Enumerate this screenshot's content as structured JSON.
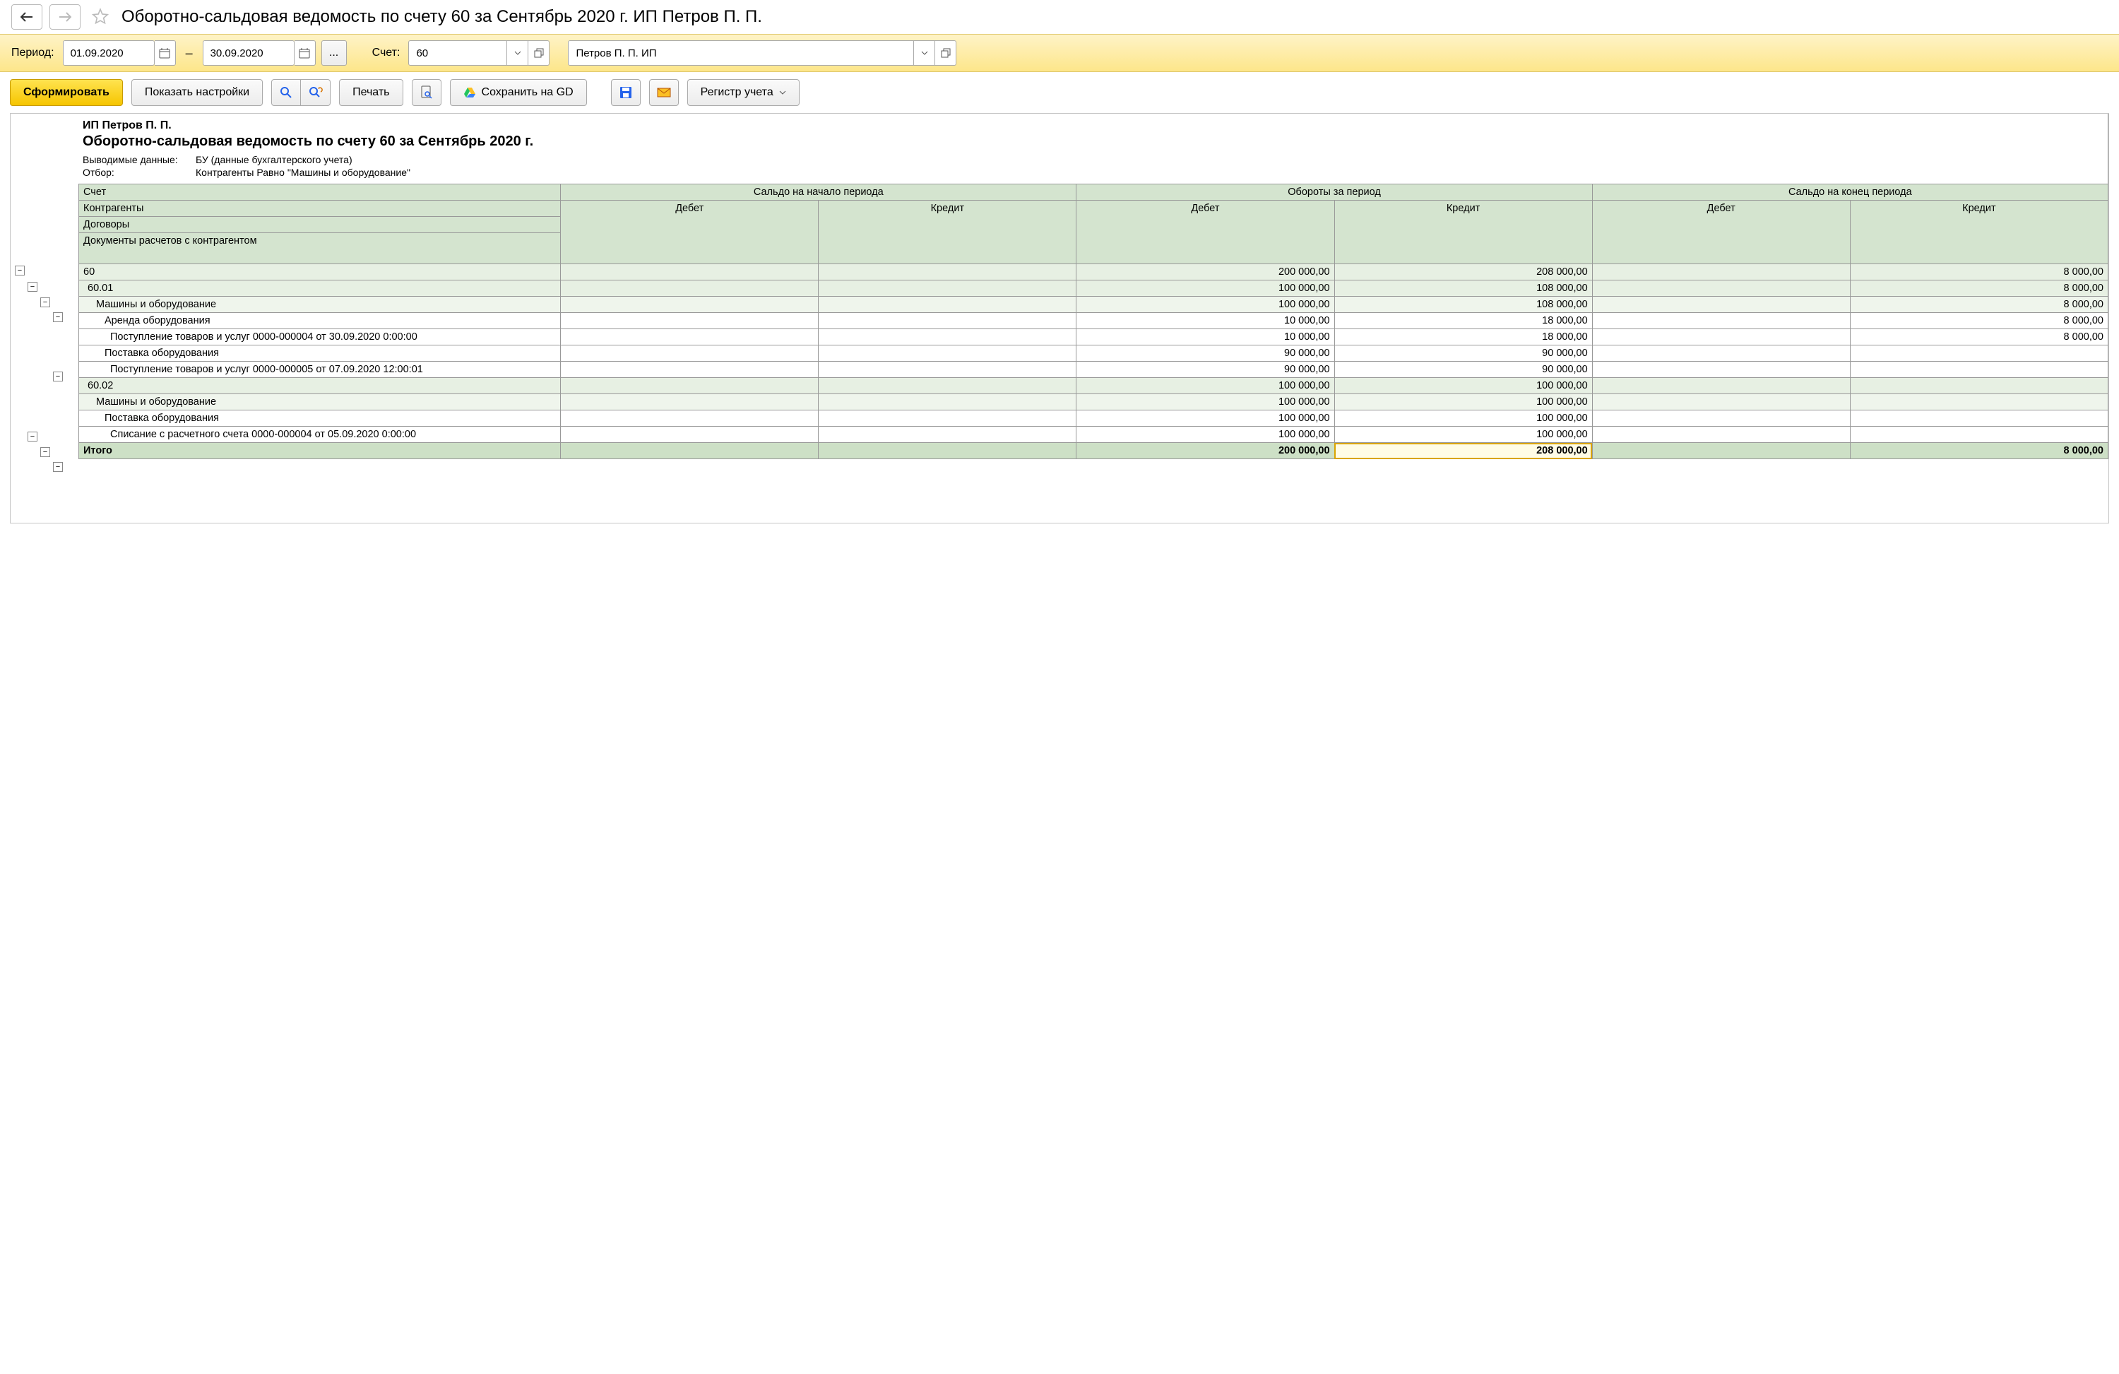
{
  "header": {
    "title": "Оборотно-сальдовая ведомость по счету 60 за Сентябрь 2020 г. ИП Петров П. П."
  },
  "period": {
    "label": "Период:",
    "from": "01.09.2020",
    "to": "30.09.2020",
    "ellipsis": "...",
    "account_label": "Счет:",
    "account": "60",
    "org": "Петров П. П. ИП"
  },
  "toolbar": {
    "generate": "Сформировать",
    "show_settings": "Показать настройки",
    "print": "Печать",
    "save_gd": "Сохранить на GD",
    "register": "Регистр учета"
  },
  "report": {
    "org": "ИП Петров П. П.",
    "title": "Оборотно-сальдовая ведомость по счету 60 за Сентябрь 2020 г.",
    "meta1_k": "Выводимые данные:",
    "meta1_v": "БУ (данные бухгалтерского учета)",
    "meta2_k": "Отбор:",
    "meta2_v": "Контрагенты Равно \"Машины и оборудование\""
  },
  "columns": {
    "account": "Счет",
    "h1": "Контрагенты",
    "h2": "Договоры",
    "h3": "Документы расчетов с контрагентом",
    "g1": "Сальдо на начало периода",
    "g2": "Обороты за период",
    "g3": "Сальдо на конец периода",
    "debit": "Дебет",
    "credit": "Кредит",
    "total": "Итого"
  },
  "rows": [
    {
      "lvl": 0,
      "shade": 1,
      "name": "60",
      "bd": "",
      "bc": "",
      "td": "200 000,00",
      "tc": "208 000,00",
      "ed": "",
      "ec": "8 000,00"
    },
    {
      "lvl": 1,
      "shade": 1,
      "name": "60.01",
      "bd": "",
      "bc": "",
      "td": "100 000,00",
      "tc": "108 000,00",
      "ed": "",
      "ec": "8 000,00"
    },
    {
      "lvl": 2,
      "shade": 2,
      "name": "Машины и оборудование",
      "bd": "",
      "bc": "",
      "td": "100 000,00",
      "tc": "108 000,00",
      "ed": "",
      "ec": "8 000,00"
    },
    {
      "lvl": 3,
      "shade": 0,
      "name": "Аренда оборудования",
      "bd": "",
      "bc": "",
      "td": "10 000,00",
      "tc": "18 000,00",
      "ed": "",
      "ec": "8 000,00"
    },
    {
      "lvl": 4,
      "shade": 0,
      "name": "Поступление товаров и услуг 0000-000004 от 30.09.2020 0:00:00",
      "bd": "",
      "bc": "",
      "td": "10 000,00",
      "tc": "18 000,00",
      "ed": "",
      "ec": "8 000,00"
    },
    {
      "lvl": 3,
      "shade": 0,
      "name": "Поставка оборудования",
      "bd": "",
      "bc": "",
      "td": "90 000,00",
      "tc": "90 000,00",
      "ed": "",
      "ec": ""
    },
    {
      "lvl": 4,
      "shade": 0,
      "name": "Поступление товаров и услуг 0000-000005 от 07.09.2020 12:00:01",
      "bd": "",
      "bc": "",
      "td": "90 000,00",
      "tc": "90 000,00",
      "ed": "",
      "ec": ""
    },
    {
      "lvl": 1,
      "shade": 1,
      "name": "60.02",
      "bd": "",
      "bc": "",
      "td": "100 000,00",
      "tc": "100 000,00",
      "ed": "",
      "ec": ""
    },
    {
      "lvl": 2,
      "shade": 2,
      "name": "Машины и оборудование",
      "bd": "",
      "bc": "",
      "td": "100 000,00",
      "tc": "100 000,00",
      "ed": "",
      "ec": ""
    },
    {
      "lvl": 3,
      "shade": 0,
      "name": "Поставка оборудования",
      "bd": "",
      "bc": "",
      "td": "100 000,00",
      "tc": "100 000,00",
      "ed": "",
      "ec": ""
    },
    {
      "lvl": 4,
      "shade": 0,
      "name": "Списание с расчетного счета 0000-000004 от 05.09.2020 0:00:00",
      "bd": "",
      "bc": "",
      "td": "100 000,00",
      "tc": "100 000,00",
      "ed": "",
      "ec": ""
    }
  ],
  "totals": {
    "bd": "",
    "bc": "",
    "td": "200 000,00",
    "tc": "208 000,00",
    "ed": "",
    "ec": "8 000,00"
  }
}
